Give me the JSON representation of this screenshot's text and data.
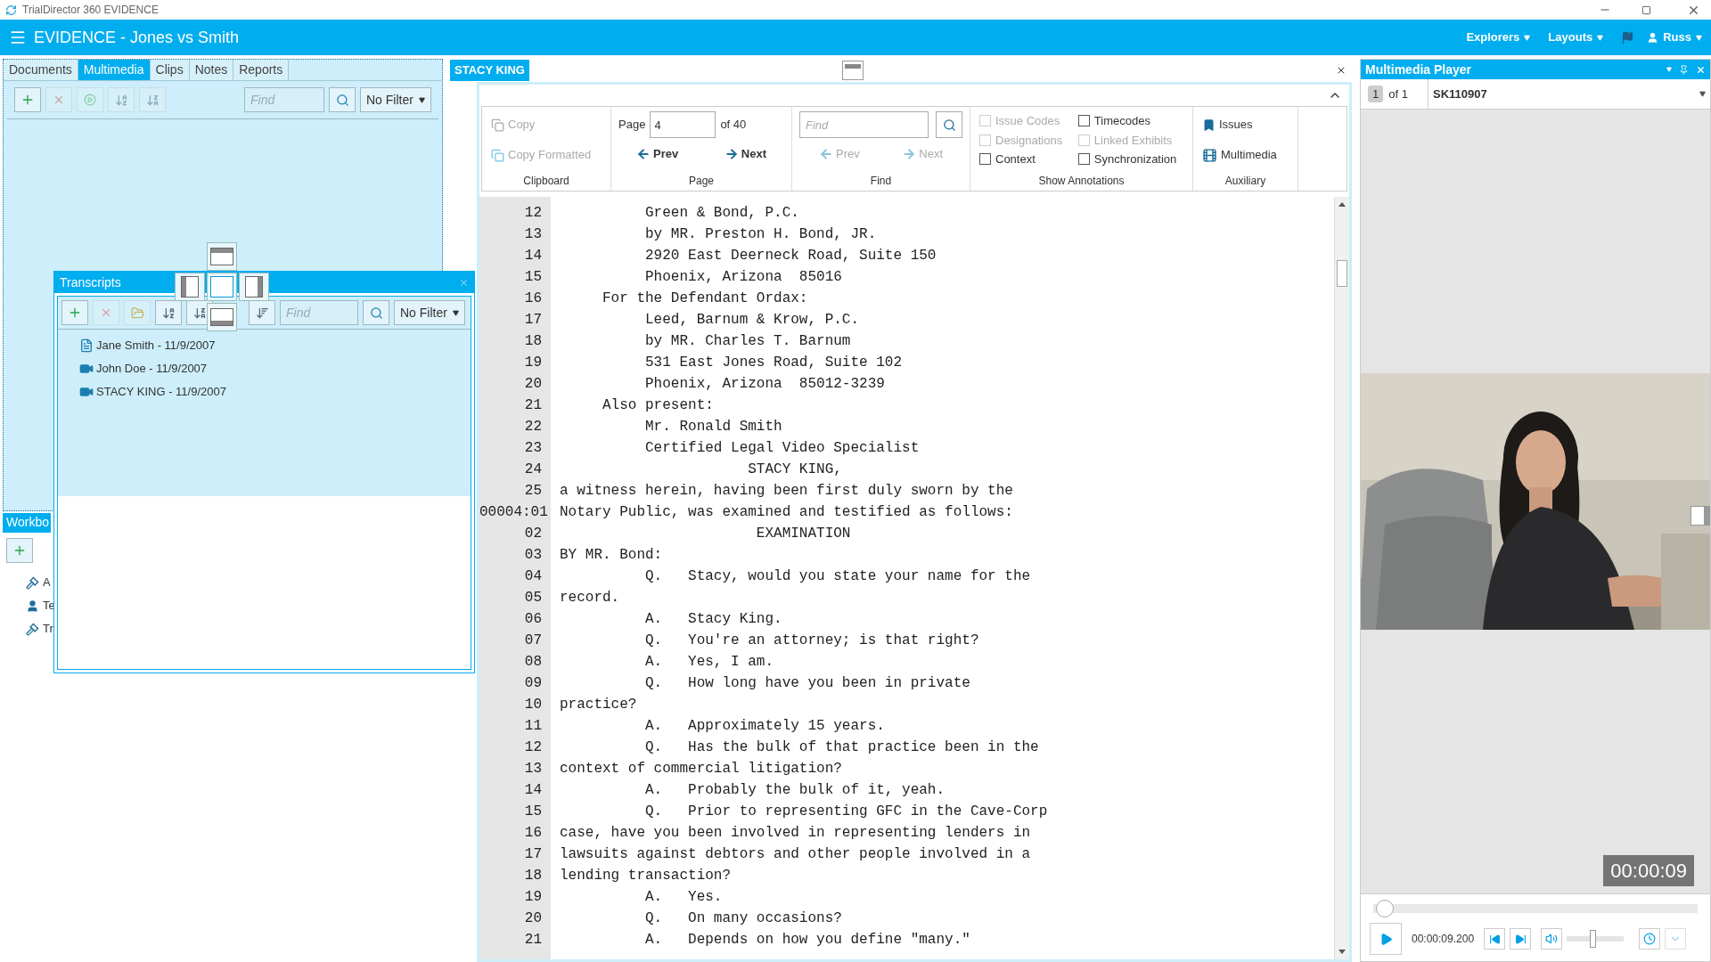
{
  "app_title": "TrialDirector 360 EVIDENCE",
  "header": {
    "title": "EVIDENCE - Jones vs Smith",
    "menus": [
      "Explorers",
      "Layouts"
    ],
    "user": "Russ"
  },
  "explorer": {
    "tabs": [
      {
        "label": "Documents",
        "selected": false
      },
      {
        "label": "Multimedia",
        "selected": true
      },
      {
        "label": "Clips",
        "selected": false
      },
      {
        "label": "Notes",
        "selected": false
      },
      {
        "label": "Reports",
        "selected": false
      }
    ],
    "find_placeholder": "Find",
    "filter": "No Filter"
  },
  "transcripts_window": {
    "title": "Transcripts",
    "find_placeholder": "Find",
    "filter": "No Filter",
    "items": [
      {
        "label": "Jane Smith - 11/9/2007",
        "kind": "document"
      },
      {
        "label": "John Doe - 11/9/2007",
        "kind": "video"
      },
      {
        "label": "STACY KING - 11/9/2007",
        "kind": "video"
      }
    ]
  },
  "workbook": {
    "title": "Workbo",
    "items": [
      {
        "label": "A",
        "kind": "gavel"
      },
      {
        "label": "Te",
        "kind": "person"
      },
      {
        "label": "Tr",
        "kind": "gavel"
      }
    ]
  },
  "document": {
    "tab": "STACY KING",
    "ribbon": {
      "clipboard": {
        "label": "Clipboard",
        "copy": "Copy",
        "copy_formatted": "Copy Formatted"
      },
      "page": {
        "label": "Page",
        "page_label": "Page",
        "value": "4",
        "of": "of 40",
        "prev": "Prev",
        "next": "Next"
      },
      "find": {
        "label": "Find",
        "placeholder": "Find",
        "prev": "Prev",
        "next": "Next"
      },
      "annotations": {
        "label": "Show Annotations",
        "options": [
          {
            "label": "Issue Codes",
            "checked": false,
            "disabled": true
          },
          {
            "label": "Designations",
            "checked": false,
            "disabled": true
          },
          {
            "label": "Context",
            "checked": false,
            "disabled": false
          },
          {
            "label": "Timecodes",
            "checked": false,
            "disabled": false
          },
          {
            "label": "Linked Exhibits",
            "checked": false,
            "disabled": true
          },
          {
            "label": "Synchronization",
            "checked": false,
            "disabled": false
          }
        ]
      },
      "auxiliary": {
        "label": "Auxiliary",
        "issues": "Issues",
        "multimedia": "Multimedia"
      }
    },
    "lines": [
      {
        "number": "12",
        "text": "          Green & Bond, P.C."
      },
      {
        "number": "13",
        "text": "          by MR. Preston H. Bond, JR."
      },
      {
        "number": "14",
        "text": "          2920 East Deerneck Road, Suite 150"
      },
      {
        "number": "15",
        "text": "          Phoenix, Arizona  85016"
      },
      {
        "number": "16",
        "text": "     For the Defendant Ordax:"
      },
      {
        "number": "17",
        "text": "          Leed, Barnum & Krow, P.C."
      },
      {
        "number": "18",
        "text": "          by MR. Charles T. Barnum"
      },
      {
        "number": "19",
        "text": "          531 East Jones Road, Suite 102"
      },
      {
        "number": "20",
        "text": "          Phoenix, Arizona  85012-3239"
      },
      {
        "number": "21",
        "text": "     Also present:"
      },
      {
        "number": "22",
        "text": "          Mr. Ronald Smith"
      },
      {
        "number": "23",
        "text": "          Certified Legal Video Specialist"
      },
      {
        "number": "24",
        "text": "                      STACY KING,"
      },
      {
        "number": "25",
        "text": "a witness herein, having been first duly sworn by the"
      },
      {
        "number": "00004:01",
        "text": "Notary Public, was examined and testified as follows:"
      },
      {
        "number": "02",
        "text": "                       EXAMINATION"
      },
      {
        "number": "03",
        "text": "BY MR. Bond:"
      },
      {
        "number": "04",
        "text": "          Q.   Stacy, would you state your name for the"
      },
      {
        "number": "05",
        "text": "record."
      },
      {
        "number": "06",
        "text": "          A.   Stacy King."
      },
      {
        "number": "07",
        "text": "          Q.   You're an attorney; is that right?"
      },
      {
        "number": "08",
        "text": "          A.   Yes, I am."
      },
      {
        "number": "09",
        "text": "          Q.   How long have you been in private"
      },
      {
        "number": "10",
        "text": "practice?"
      },
      {
        "number": "11",
        "text": "          A.   Approximately 15 years."
      },
      {
        "number": "12",
        "text": "          Q.   Has the bulk of that practice been in the"
      },
      {
        "number": "13",
        "text": "context of commercial litigation?"
      },
      {
        "number": "14",
        "text": "          A.   Probably the bulk of it, yeah."
      },
      {
        "number": "15",
        "text": "          Q.   Prior to representing GFC in the Cave-Corp"
      },
      {
        "number": "16",
        "text": "case, have you been involved in representing lenders in"
      },
      {
        "number": "17",
        "text": "lawsuits against debtors and other people involved in a"
      },
      {
        "number": "18",
        "text": "lending transaction?"
      },
      {
        "number": "19",
        "text": "          A.   Yes."
      },
      {
        "number": "20",
        "text": "          Q.   On many occasions?"
      },
      {
        "number": "21",
        "text": "          A.   Depends on how you define \"many.\""
      }
    ]
  },
  "player": {
    "title": "Multimedia Player",
    "index": "1",
    "of": "of 1",
    "clip": "SK110907",
    "overlay_time": "00:00:09",
    "position": {
      "level": 0.01
    },
    "time": "00:00:09.200",
    "volume": {
      "level": 0.45
    }
  }
}
